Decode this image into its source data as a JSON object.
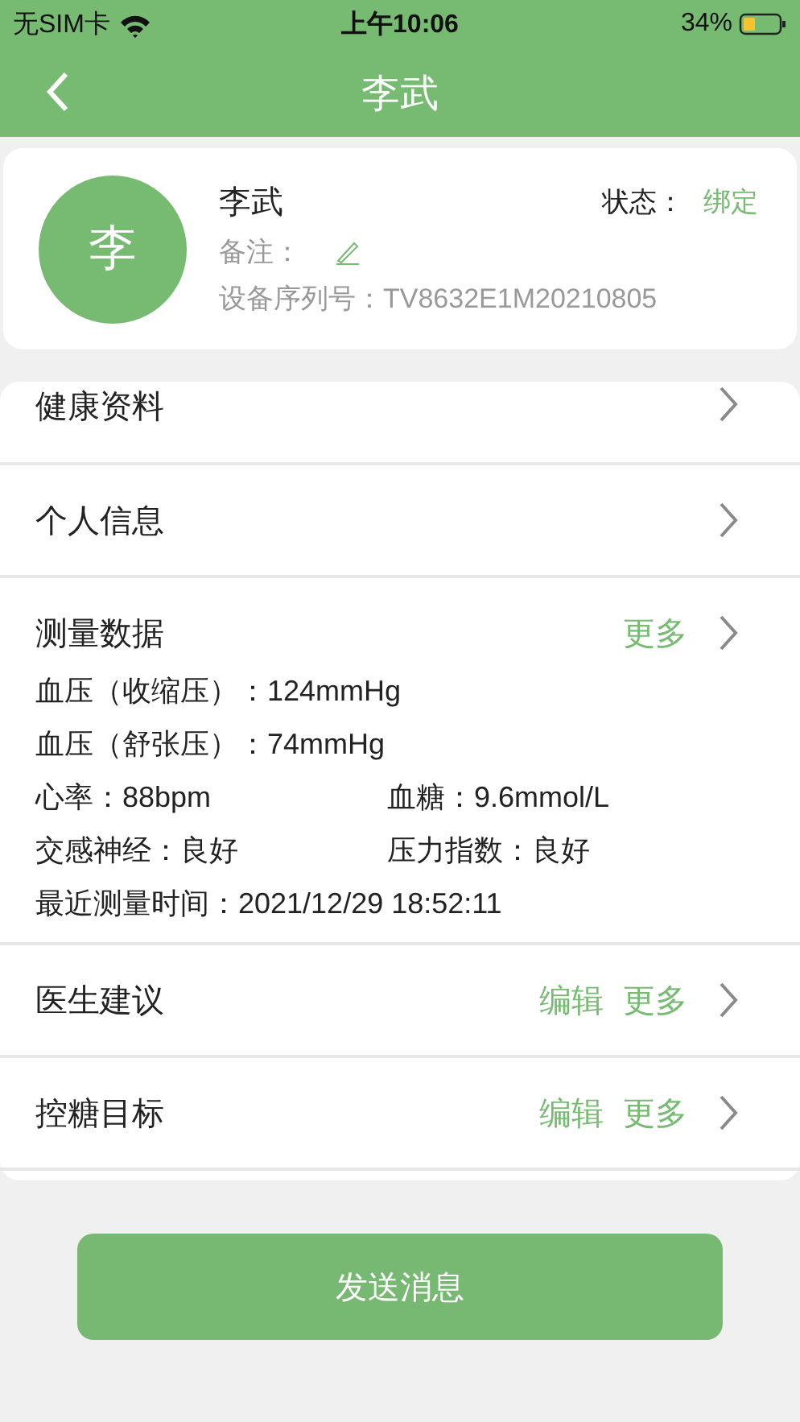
{
  "status_bar": {
    "carrier": "无SIM卡",
    "time": "上午10:06",
    "battery": "34%"
  },
  "nav": {
    "title": "李武"
  },
  "profile": {
    "avatar": "李",
    "name": "李武",
    "status_label": "状态：",
    "status_value": "绑定",
    "note_label": "备注：",
    "serial": "设备序列号：TV8632E1M20210805"
  },
  "sections": [
    {
      "kind": "link",
      "title": "健康资料"
    },
    {
      "kind": "link",
      "title": "个人信息"
    },
    {
      "kind": "data",
      "title": "测量数据",
      "more": "更多",
      "lines": [
        [
          "血压（收缩压）：124mmHg"
        ],
        [
          "血压（舒张压）：74mmHg"
        ],
        [
          "心率：88bpm",
          "血糖：9.6mmol/L"
        ],
        [
          "交感神经：良好",
          "压力指数：良好"
        ],
        [
          "最近测量时间：2021/12/29 18:52:11"
        ]
      ]
    },
    {
      "kind": "actions",
      "title": "医生建议",
      "edit": "编辑",
      "more": "更多"
    },
    {
      "kind": "actions",
      "title": "控糖目标",
      "edit": "编辑",
      "more": "更多"
    }
  ],
  "send_button": "发送消息"
}
